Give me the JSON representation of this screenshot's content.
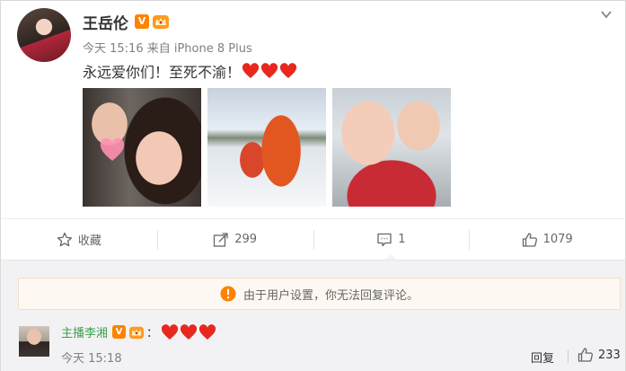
{
  "post": {
    "username": "王岳伦",
    "verified_badge": "V",
    "meta": "今天 15:16 来自 iPhone 8 Plus",
    "text": "永远爱你们！至死不渝！",
    "icons": [
      "chevron-down-icon",
      "verified-icon",
      "crown-icon",
      "heart-icon"
    ],
    "photos": [
      "photo-1",
      "photo-2",
      "photo-3"
    ]
  },
  "actions": {
    "favorite_label": "收藏",
    "repost_count": "299",
    "comment_count": "1",
    "like_count": "1079"
  },
  "comments": {
    "notice": "由于用户设置，你无法回复评论。",
    "items": [
      {
        "username": "主播李湘",
        "verified_badge": "V",
        "colon": "：",
        "time": "今天 15:18",
        "reply_label": "回复",
        "like_count": "233"
      }
    ]
  },
  "colors": {
    "accent_orange": "#ff8200",
    "heart_red": "#e8281e",
    "comment_username": "#3e9f4a",
    "comment_bg": "#f2f2f5",
    "notice_bg": "#fdf8f2"
  }
}
